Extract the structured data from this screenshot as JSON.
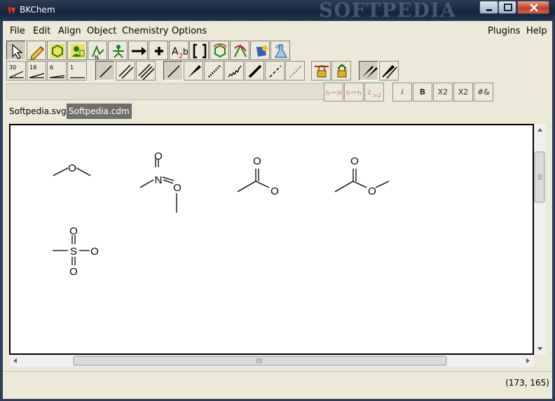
{
  "window": {
    "title": "BKChem",
    "watermark": "SOFTPEDIA",
    "controls": [
      "minimize",
      "maximize",
      "close"
    ]
  },
  "menubar": {
    "left": [
      "File",
      "Edit",
      "Align",
      "Object",
      "Chemistry",
      "Options"
    ],
    "right": [
      "Plugins",
      "Help"
    ]
  },
  "toolbar_modes": [
    "select-arrow-icon",
    "edit-pencil-icon",
    "template-hexagon-icon",
    "user-template-icon",
    "draw-bond-icon",
    "rotate-molecule-icon",
    "arrow-icon",
    "plus-icon",
    "text-icon",
    "bracket-icon",
    "ring-template-icon",
    "vector-graphics-icon",
    "mark-icon",
    "reaction-flask-icon"
  ],
  "angle_buttons": [
    {
      "label": "30"
    },
    {
      "label": "18"
    },
    {
      "label": "6"
    },
    {
      "label": "1"
    }
  ],
  "format_buttons": {
    "text_labels": [
      "i",
      "B",
      "X2",
      "X2",
      "#&"
    ]
  },
  "tabs": [
    {
      "label": "Softpedia.svg",
      "active": false
    },
    {
      "label": "Softpedia.cdm",
      "active": true
    }
  ],
  "molecules": {
    "atoms": {
      "ether_o": "O",
      "nitro_n": "N",
      "nitro_o1": "O",
      "nitro_o2": "O",
      "acid_o1": "O",
      "acid_o2": "O",
      "ester_o1": "O",
      "ester_o2": "O",
      "sulfur": "S",
      "sulf_o_top": "O",
      "sulf_o_right": "O",
      "sulf_o_bottom": "O"
    }
  },
  "status": {
    "coords": "(173, 165)"
  }
}
